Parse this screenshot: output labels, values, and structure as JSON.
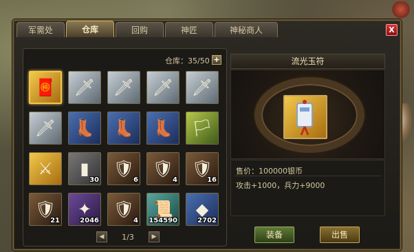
{
  "tabs": [
    {
      "label": "军需处",
      "active": false
    },
    {
      "label": "仓库",
      "active": true
    },
    {
      "label": "回购",
      "active": false
    },
    {
      "label": "神匠",
      "active": false
    },
    {
      "label": "神秘商人",
      "active": false
    }
  ],
  "close_label": "X",
  "inventory": {
    "capacity_label": "仓库：35/50",
    "add_label": "+",
    "page": "1/3",
    "prev_label": "◀",
    "next_label": "▶",
    "slots": [
      {
        "icon": "jade-talisman-icon",
        "bg": "gold",
        "glyph": "🧧",
        "count": "",
        "selected": true
      },
      {
        "icon": "spear-icon",
        "bg": "silver",
        "glyph": "🗡",
        "count": ""
      },
      {
        "icon": "spear-icon",
        "bg": "silver",
        "glyph": "🗡",
        "count": ""
      },
      {
        "icon": "spear-icon",
        "bg": "silver",
        "glyph": "🗡",
        "count": ""
      },
      {
        "icon": "spear-icon",
        "bg": "silver",
        "glyph": "🗡",
        "count": ""
      },
      {
        "icon": "spear-icon",
        "bg": "silver",
        "glyph": "🗡",
        "count": ""
      },
      {
        "icon": "boots-icon",
        "bg": "blue",
        "glyph": "👢",
        "count": ""
      },
      {
        "icon": "boots-icon",
        "bg": "blue",
        "glyph": "👢",
        "count": ""
      },
      {
        "icon": "boots-icon",
        "bg": "blue",
        "glyph": "👢",
        "count": ""
      },
      {
        "icon": "banner-icon",
        "bg": "green",
        "glyph": "🏳",
        "count": ""
      },
      {
        "icon": "blade-icon",
        "bg": "gold",
        "glyph": "⚔",
        "count": ""
      },
      {
        "icon": "iron-ingot-icon",
        "bg": "grey",
        "glyph": "▮",
        "count": "30"
      },
      {
        "icon": "armor-icon",
        "bg": "brown",
        "glyph": "🛡",
        "count": "6"
      },
      {
        "icon": "armor-icon",
        "bg": "brown",
        "glyph": "🛡",
        "count": "4"
      },
      {
        "icon": "armor-icon",
        "bg": "brown",
        "glyph": "🛡",
        "count": "16"
      },
      {
        "icon": "armor-icon",
        "bg": "brown",
        "glyph": "🛡",
        "count": "21"
      },
      {
        "icon": "ore-icon",
        "bg": "purple",
        "glyph": "✦",
        "count": "2046"
      },
      {
        "icon": "armor-icon",
        "bg": "brown",
        "glyph": "🛡",
        "count": "4"
      },
      {
        "icon": "scroll-icon",
        "bg": "teal",
        "glyph": "📜",
        "count": "154590"
      },
      {
        "icon": "crystal-card-icon",
        "bg": "blue",
        "glyph": "◆",
        "count": "2702"
      }
    ]
  },
  "detail": {
    "title": "流光玉符",
    "price": "售价：100000银币",
    "stats": "攻击+1000，兵力+9000",
    "equip_label": "装备",
    "sell_label": "出售",
    "icon": "jade-talisman-icon"
  }
}
